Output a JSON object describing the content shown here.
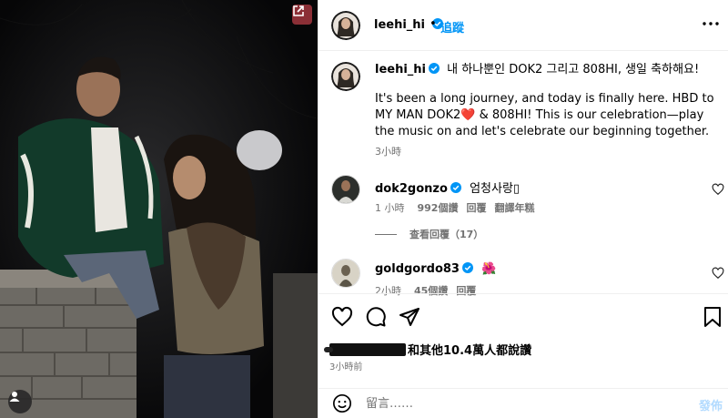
{
  "post": {
    "author": "leehi_hi",
    "follow_label": "追蹤",
    "separator": "•"
  },
  "caption": {
    "author": "leehi_hi",
    "line1": "내 하나뿐인 DOK2 그리고 808HI, 생일 축하해요!",
    "line2_part1": "It's been a long journey, and today is finally here. HBD to MY MAN DOK2",
    "line2_heart": "❤️",
    "line2_part2": " & 808HI! This is our celebration—play the music on and let's celebrate our beginning together.",
    "time": "3小時"
  },
  "comments": [
    {
      "author": "dok2gonzo",
      "text": "엄청사랑▯",
      "time": "1 小時",
      "likes": "992個讚",
      "reply": "回覆",
      "translate": "翻譯年糕"
    },
    {
      "author": "goldgordo83",
      "text": "🌺",
      "time": "2小時",
      "likes": "45個讚",
      "reply": "回覆"
    }
  ],
  "view_replies": "查看回覆（17）",
  "likes_summary": "和其他10.4萬人都說讚",
  "post_time": "3小時前",
  "comment_box": {
    "placeholder": "留言……",
    "post_label": "發佈"
  },
  "colors": {
    "link_blue": "#0095f6",
    "verified_blue": "#0095f6",
    "muted_text": "#737373",
    "post_disabled": "#b3dbff",
    "external_button": "#8b2f36"
  },
  "icons": {
    "share": "external-link-icon",
    "more": "more-options-icon",
    "like": "heart-icon",
    "comment": "comment-icon",
    "share_post": "paper-plane-icon",
    "save": "bookmark-icon",
    "emoji": "emoji-icon",
    "tag": "user-tag-icon"
  }
}
